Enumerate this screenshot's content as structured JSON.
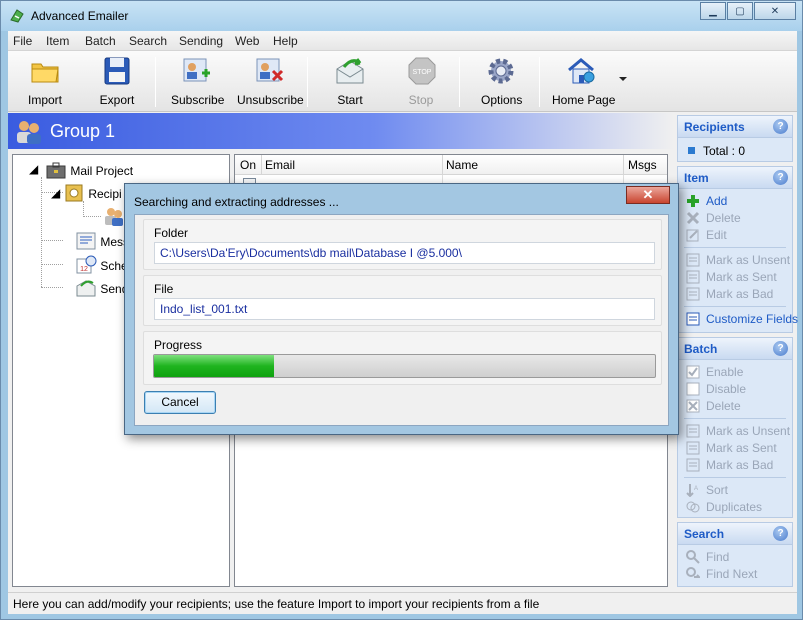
{
  "window": {
    "title": "Advanced Emailer"
  },
  "menu": [
    "File",
    "Item",
    "Batch",
    "Search",
    "Sending",
    "Web",
    "Help"
  ],
  "toolbar": {
    "import": "Import",
    "export": "Export",
    "subscribe": "Subscribe",
    "unsubscribe": "Unsubscribe",
    "start": "Start",
    "stop": "Stop",
    "options": "Options",
    "home_page": "Home Page"
  },
  "group": {
    "title": "Group 1"
  },
  "tree": {
    "root": "Mail Project",
    "items": [
      "Recipi",
      "Mess",
      "Sche",
      "Send"
    ]
  },
  "list": {
    "columns": [
      "On",
      "Email",
      "Name",
      "Msgs"
    ]
  },
  "side": {
    "recipients": {
      "header": "Recipients",
      "total": "Total : 0"
    },
    "item": {
      "header": "Item",
      "add": "Add",
      "delete": "Delete",
      "edit": "Edit",
      "mark_unsent": "Mark as Unsent",
      "mark_sent": "Mark as Sent",
      "mark_bad": "Mark as Bad",
      "customize": "Customize Fields"
    },
    "batch": {
      "header": "Batch",
      "enable": "Enable",
      "disable": "Disable",
      "delete": "Delete",
      "mark_unsent": "Mark as Unsent",
      "mark_sent": "Mark as Sent",
      "mark_bad": "Mark as Bad",
      "sort": "Sort",
      "duplicates": "Duplicates"
    },
    "search": {
      "header": "Search",
      "find": "Find",
      "find_next": "Find Next"
    }
  },
  "status": {
    "text": "Here you can add/modify your recipients; use the feature Import to import your recipients from a file"
  },
  "dialog": {
    "title": "Searching and extracting addresses ...",
    "folder_label": "Folder",
    "folder_value": "C:\\Users\\Da'Ery\\Documents\\db mail\\Database I @5.000\\",
    "file_label": "File",
    "file_value": "Indo_list_001.txt",
    "progress_label": "Progress",
    "progress": 0.24,
    "cancel": "Cancel"
  },
  "colors": {
    "accent": "#1e5bc6",
    "header_gradient": "#3a5ce0",
    "progress": "#1fb41f"
  }
}
